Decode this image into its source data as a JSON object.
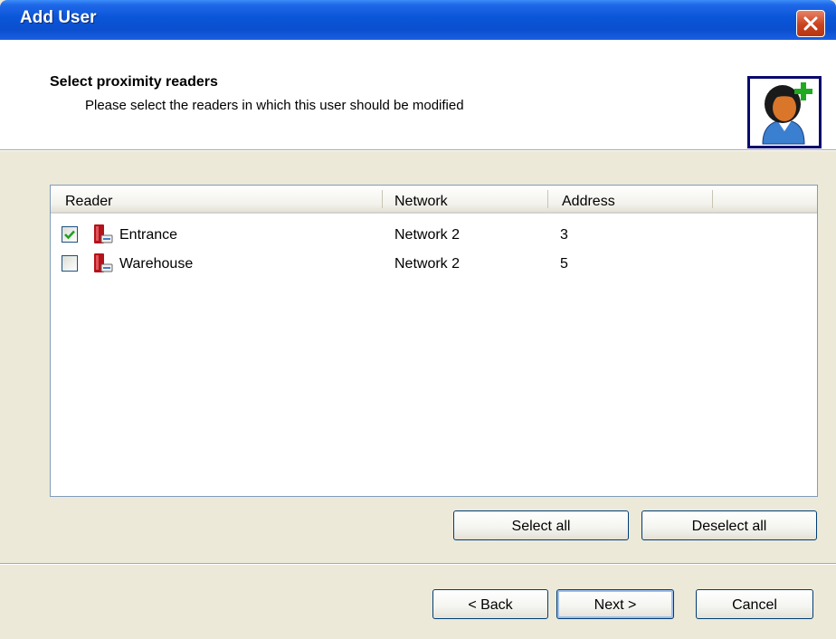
{
  "window": {
    "title": "Add User"
  },
  "header": {
    "title": "Select proximity readers",
    "subtitle": "Please select the readers in which this user should be modified"
  },
  "list": {
    "columns": [
      "Reader",
      "Network",
      "Address"
    ],
    "rows": [
      {
        "checked": true,
        "reader": "Entrance",
        "network": "Network 2",
        "address": "3"
      },
      {
        "checked": false,
        "reader": "Warehouse",
        "network": "Network 2",
        "address": "5"
      }
    ]
  },
  "buttons": {
    "select_all": "Select all",
    "deselect_all": "Deselect all",
    "back": "< Back",
    "next": "Next >",
    "cancel": "Cancel"
  },
  "icons": {
    "close": "close-icon",
    "user_add": "user-add-icon",
    "reader": "reader-icon",
    "checkmark": "checkmark-icon"
  },
  "colors": {
    "titlebar": "#0a55d8",
    "close_button": "#c9431e",
    "window_bg": "#ece9d8",
    "check_green": "#21a121",
    "reader_red": "#b3131a",
    "add_plus": "#1faa1f"
  }
}
